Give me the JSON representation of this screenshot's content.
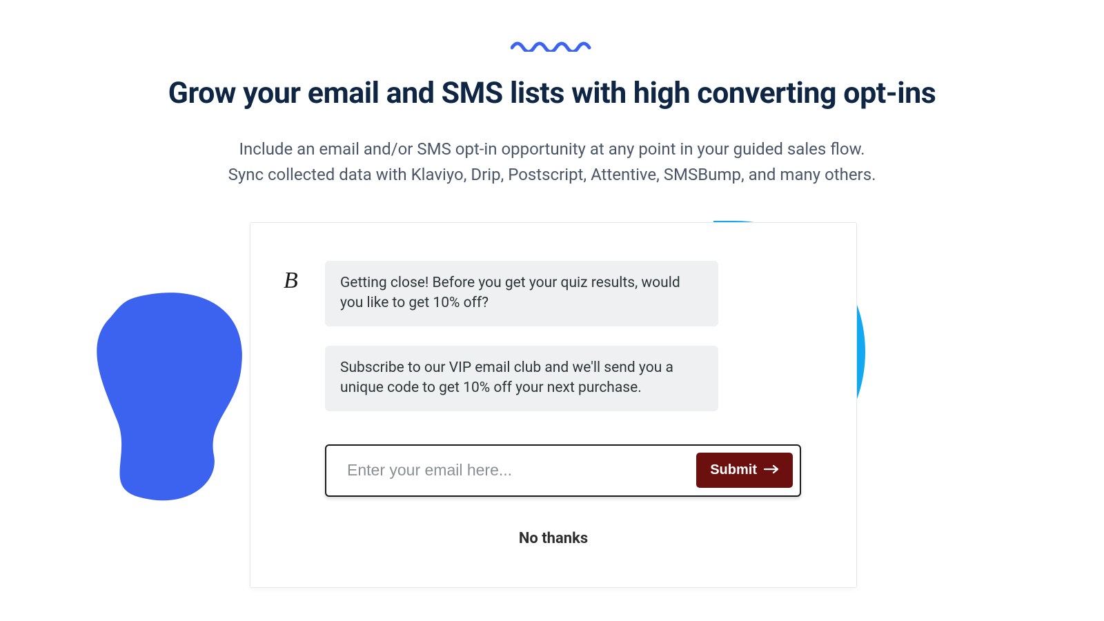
{
  "hero": {
    "headline": "Grow your email and SMS lists with high converting opt-ins",
    "subtext_line1": "Include an email and/or SMS opt-in opportunity at any point in your guided sales flow.",
    "subtext_line2": "Sync collected data with Klaviyo, Drip, Postscript, Attentive, SMSBump, and many others."
  },
  "card": {
    "avatar_glyph": "B",
    "bubble1": "Getting close! Before you get your quiz results, would you like to get 10% off?",
    "bubble2": "Subscribe to our VIP email club and we'll send you a unique code to get 10% off your next purchase.",
    "email_placeholder": "Enter your email here...",
    "submit_label": "Submit",
    "no_thanks_label": "No thanks"
  },
  "colors": {
    "accent_blue": "#3b63f0",
    "bright_blue": "#13a9f0",
    "submit_bg": "#6b0f0f",
    "text_dark": "#0e2643"
  }
}
